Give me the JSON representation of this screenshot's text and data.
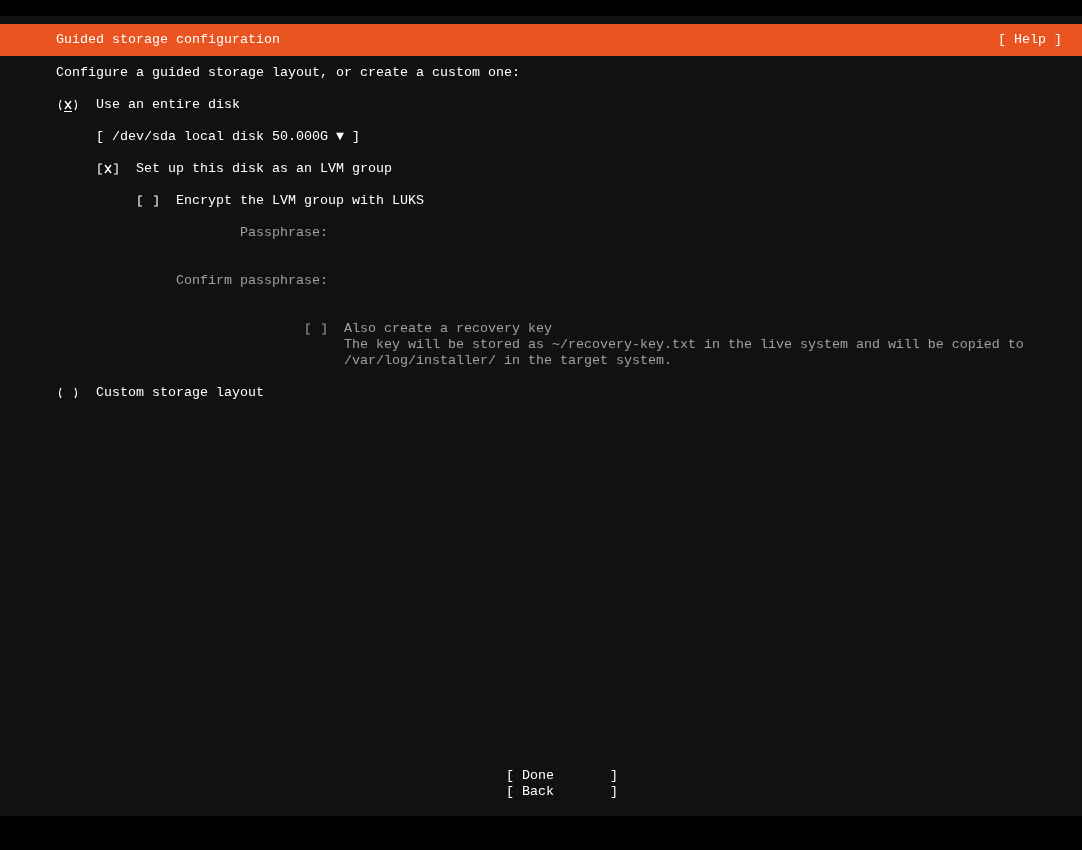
{
  "header": {
    "title": "Guided storage configuration",
    "help": "[ Help ]"
  },
  "intro": "Configure a guided storage layout, or create a custom one:",
  "options": [
    {
      "label": "Use an entire disk",
      "selected": true,
      "focused": true,
      "disk_dropdown": "[ /dev/sda local disk 50.000G ▼ ]",
      "lvm": {
        "label": "Set up this disk as an LVM group",
        "checked": true,
        "disabled": false
      },
      "encrypt": {
        "label": "Encrypt the LVM group with LUKS",
        "checked": false,
        "disabled": false
      },
      "passphrase_fields": [
        {
          "label": "Passphrase:",
          "disabled": true
        },
        {
          "label": "Confirm passphrase:",
          "disabled": true
        }
      ],
      "recovery": {
        "label": "Also create a recovery key",
        "checked": false,
        "disabled": true,
        "description": [
          "The key will be stored as ~/recovery-key.txt in the live system and will be copied to",
          "/var/log/installer/ in the target system."
        ]
      }
    },
    {
      "label": "Custom storage layout",
      "selected": false,
      "focused": false
    }
  ],
  "buttons": [
    {
      "label": "[ Done       ]"
    },
    {
      "label": "[ Back       ]"
    }
  ]
}
